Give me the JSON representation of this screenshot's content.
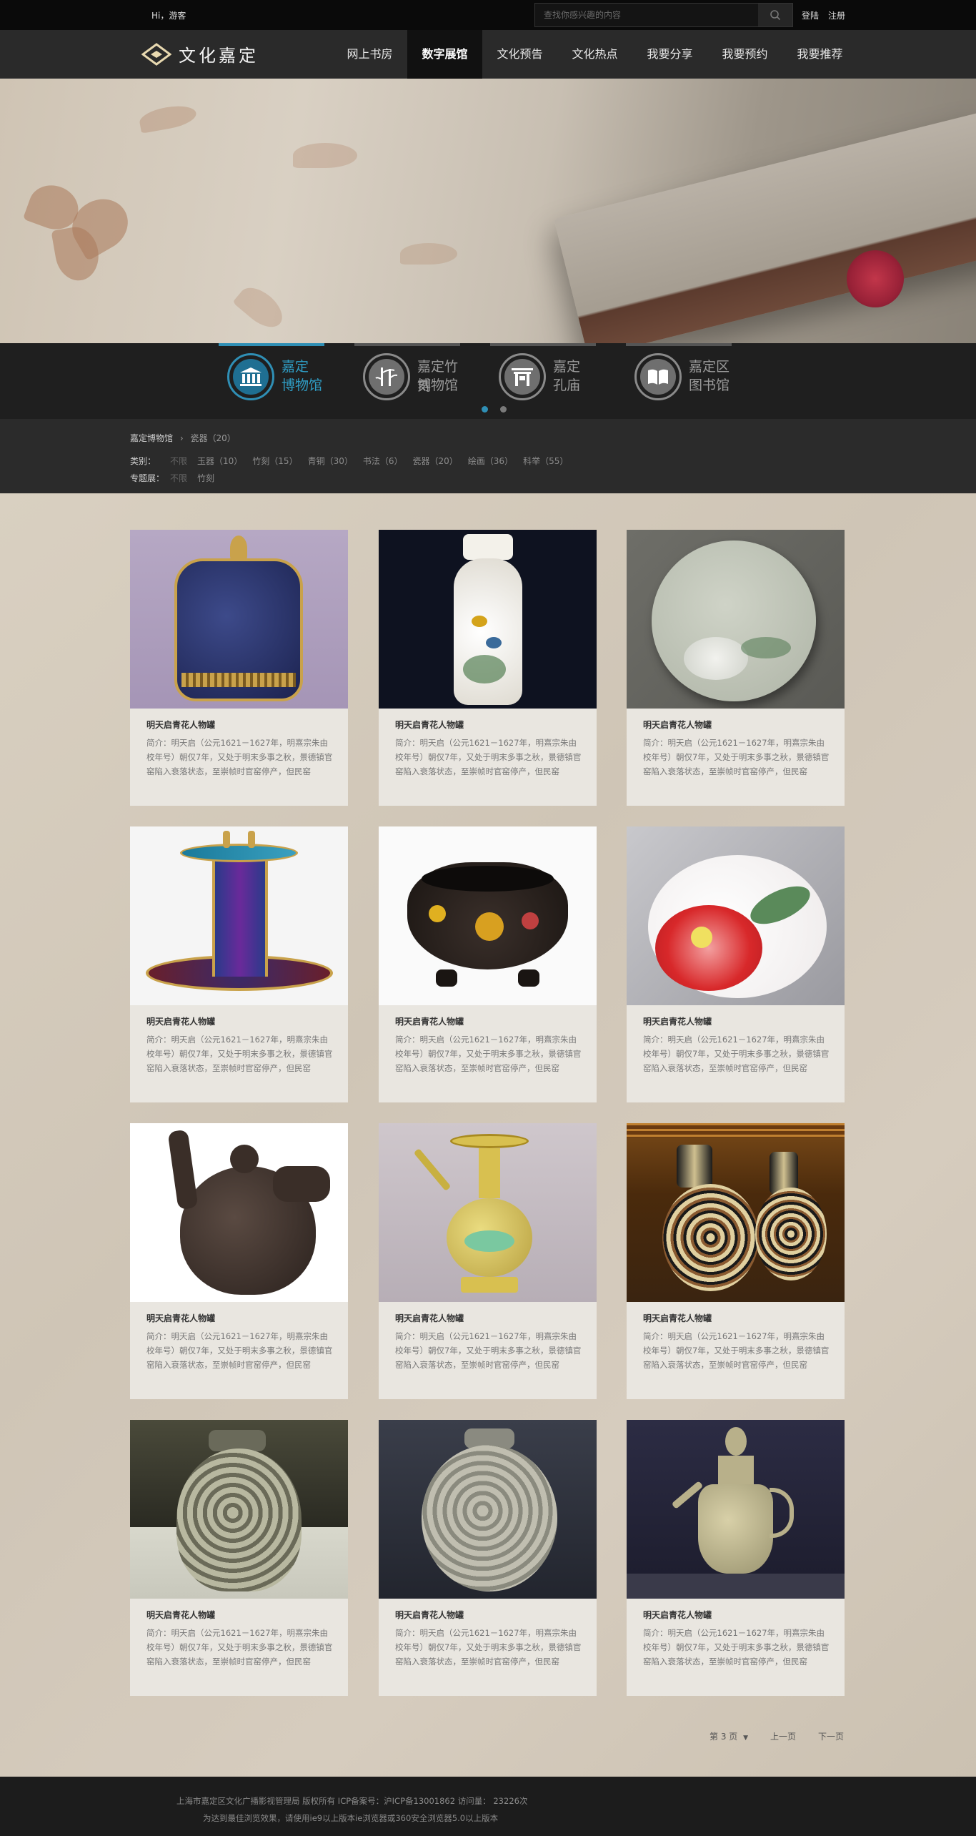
{
  "topbar": {
    "greeting": "Hi，游客",
    "search_placeholder": "查找你感兴趣的内容",
    "login": "登陆",
    "register": "注册"
  },
  "header": {
    "logo_text": "文化嘉定",
    "nav": [
      "网上书房",
      "数字展馆",
      "文化预告",
      "文化热点",
      "我要分享",
      "我要预约",
      "我要推荐"
    ],
    "active_nav": "数字展馆"
  },
  "museums": [
    {
      "line1": "嘉定",
      "line2": "博物馆",
      "icon": "museum-building-icon",
      "active": true
    },
    {
      "line1": "嘉定竹刻",
      "line2": "博物馆",
      "icon": "bamboo-icon",
      "active": false
    },
    {
      "line1": "嘉定",
      "line2": "孔庙",
      "icon": "temple-gate-icon",
      "active": false
    },
    {
      "line1": "嘉定区",
      "line2": "图书馆",
      "icon": "open-book-icon",
      "active": false
    }
  ],
  "breadcrumb": {
    "home": "嘉定博物馆",
    "sep": "›",
    "current": "瓷器（20）"
  },
  "filters": {
    "category_label": "类别：",
    "categories": [
      "不限",
      "玉器（10）",
      "竹刻（15）",
      "青铜（30）",
      "书法（6）",
      "瓷器（20）",
      "绘画（36）",
      "科举（55）"
    ],
    "topic_label": "专题展：",
    "topics": [
      "不限",
      "竹刻"
    ]
  },
  "card": {
    "title": "明天启青花人物罐",
    "desc": "简介：明天启（公元1621－1627年，明熹宗朱由校年号）朝仅7年，又处于明末多事之秋，景德镇官窑陷入衰落状态，至崇帧时官窑停产，但民窑"
  },
  "items": [
    {
      "image": "cloisonne-lidded-jar"
    },
    {
      "image": "famille-rose-bird-vase"
    },
    {
      "image": "celadon-flower-plate"
    },
    {
      "image": "cloisonne-jue-cup"
    },
    {
      "image": "enamel-lion-bowl"
    },
    {
      "image": "red-hibiscus-porcelain"
    },
    {
      "image": "dragon-clay-teapot"
    },
    {
      "image": "yellow-enamel-ewer"
    },
    {
      "image": "cloisonne-vase-pair"
    },
    {
      "image": "carved-peony-jar"
    },
    {
      "image": "celadon-peony-jar"
    },
    {
      "image": "celadon-ewer"
    }
  ],
  "pager": {
    "current": "第 3 页",
    "prev": "上一页",
    "next": "下一页"
  },
  "footer": {
    "line1": "上海市嘉定区文化广播影视管理局 版权所有 ICP备案号：沪ICP备13001862 访问量： 23226次",
    "line2": "为达到最佳浏览效果，请使用ie9以上版本ie浏览器或360安全浏览器5.0以上版本"
  },
  "colors": {
    "accent": "#2f8fb5",
    "topbar": "#0a0a0a",
    "nav": "#2a2a2a",
    "page_bg": "#d8cfc0",
    "card_bg": "#e9e6e0"
  }
}
